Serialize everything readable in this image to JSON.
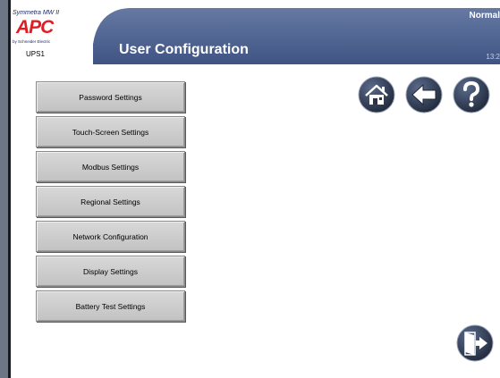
{
  "header": {
    "product_name": "Symmetra MW II",
    "brand": "APC",
    "brand_sub": "by Schneider Electric",
    "device_name": "UPS1",
    "title": "User Configuration",
    "status": "Normal",
    "time": "13:2"
  },
  "menu": {
    "items": [
      {
        "label": "Password Settings"
      },
      {
        "label": "Touch-Screen Settings"
      },
      {
        "label": "Modbus Settings"
      },
      {
        "label": "Regional Settings"
      },
      {
        "label": "Network Configuration"
      },
      {
        "label": "Display Settings"
      },
      {
        "label": "Battery Test Settings"
      }
    ]
  },
  "nav": {
    "home_icon": "home-icon",
    "back_icon": "back-arrow-icon",
    "help_icon": "help-question-icon",
    "exit_icon": "exit-door-icon"
  },
  "colors": {
    "header_blue": "#4a5f8c",
    "brand_red": "#e21b24",
    "button_gray": "#cfcfcf",
    "icon_dark": "#2a3448"
  }
}
